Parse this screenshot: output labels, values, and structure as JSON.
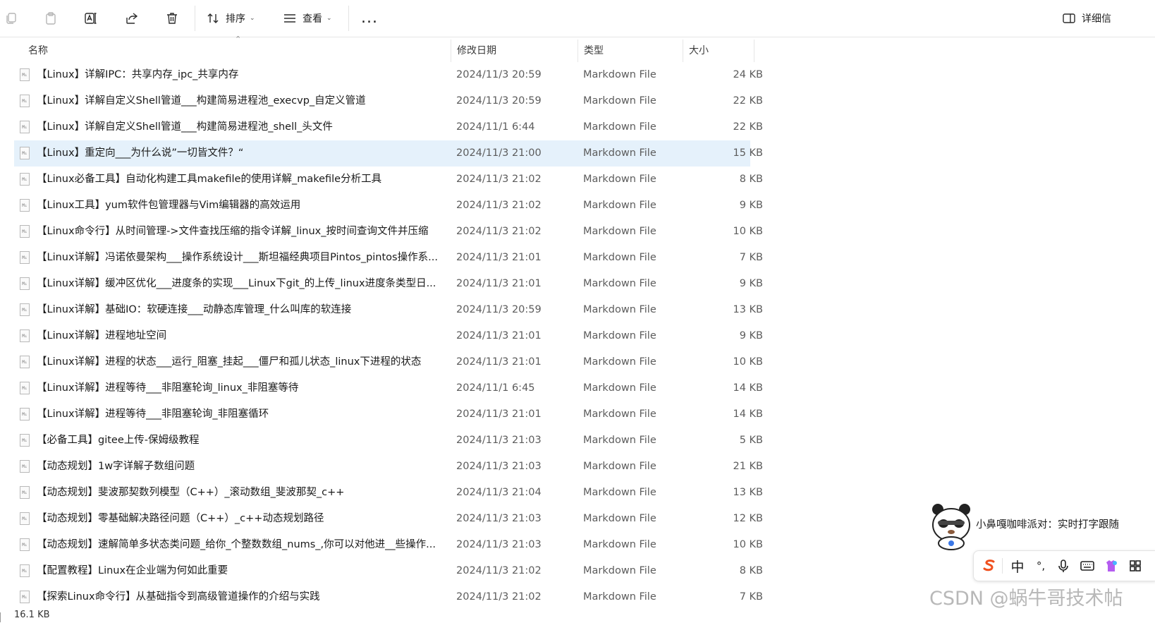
{
  "toolbar": {
    "sort_label": "排序",
    "view_label": "查看",
    "more_label": "...",
    "details_label": "详细信"
  },
  "columns": {
    "name": "名称",
    "date": "修改日期",
    "type": "类型",
    "size": "大小"
  },
  "files": [
    {
      "name": "【Linux】详解IPC：共享内存_ipc_共享内存",
      "date": "2024/11/3 20:59",
      "type": "Markdown File",
      "size": "24 KB"
    },
    {
      "name": "【Linux】详解自定义Shell管道___构建简易进程池_execvp_自定义管道",
      "date": "2024/11/3 20:59",
      "type": "Markdown File",
      "size": "22 KB"
    },
    {
      "name": "【Linux】详解自定义Shell管道___构建简易进程池_shell_头文件",
      "date": "2024/11/1 6:44",
      "type": "Markdown File",
      "size": "22 KB"
    },
    {
      "name": "【Linux】重定向___为什么说”一切皆文件？“",
      "date": "2024/11/3 21:00",
      "type": "Markdown File",
      "size": "15 KB",
      "selected": true
    },
    {
      "name": "【Linux必备工具】自动化构建工具makefile的使用详解_makefile分析工具",
      "date": "2024/11/3 21:02",
      "type": "Markdown File",
      "size": "8 KB"
    },
    {
      "name": "【Linux工具】yum软件包管理器与Vim编辑器的高效运用",
      "date": "2024/11/3 21:02",
      "type": "Markdown File",
      "size": "9 KB"
    },
    {
      "name": "【Linux命令行】从时间管理->文件查找压缩的指令详解_linux_按时间查询文件并压缩",
      "date": "2024/11/3 21:02",
      "type": "Markdown File",
      "size": "10 KB"
    },
    {
      "name": "【Linux详解】冯诺依曼架构___操作系统设计___斯坦福经典项目Pintos_pintos操作系...",
      "date": "2024/11/3 21:01",
      "type": "Markdown File",
      "size": "7 KB"
    },
    {
      "name": "【Linux详解】缓冲区优化___进度条的实现___Linux下git_的上传_linux进度条类型日...",
      "date": "2024/11/3 21:01",
      "type": "Markdown File",
      "size": "9 KB"
    },
    {
      "name": "【Linux详解】基础IO：软硬连接___动静态库管理_什么叫库的软连接",
      "date": "2024/11/3 20:59",
      "type": "Markdown File",
      "size": "13 KB"
    },
    {
      "name": "【Linux详解】进程地址空间",
      "date": "2024/11/3 21:01",
      "type": "Markdown File",
      "size": "9 KB"
    },
    {
      "name": "【Linux详解】进程的状态___运行_阻塞_挂起___僵尸和孤儿状态_linux下进程的状态",
      "date": "2024/11/3 21:01",
      "type": "Markdown File",
      "size": "10 KB"
    },
    {
      "name": "【Linux详解】进程等待___非阻塞轮询_linux_非阻塞等待",
      "date": "2024/11/1 6:45",
      "type": "Markdown File",
      "size": "14 KB"
    },
    {
      "name": "【Linux详解】进程等待___非阻塞轮询_非阻塞循环",
      "date": "2024/11/3 21:01",
      "type": "Markdown File",
      "size": "14 KB"
    },
    {
      "name": "【必备工具】gitee上传-保姆级教程",
      "date": "2024/11/3 21:03",
      "type": "Markdown File",
      "size": "5 KB"
    },
    {
      "name": "【动态规划】1w字详解子数组问题",
      "date": "2024/11/3 21:03",
      "type": "Markdown File",
      "size": "21 KB"
    },
    {
      "name": "【动态规划】斐波那契数列模型（C++）_滚动数组_斐波那契_c++",
      "date": "2024/11/3 21:04",
      "type": "Markdown File",
      "size": "13 KB"
    },
    {
      "name": "【动态规划】零基础解决路径问题（C++）_c++动态规划路径",
      "date": "2024/11/3 21:03",
      "type": "Markdown File",
      "size": "12 KB"
    },
    {
      "name": "【动态规划】速解简单多状态类问题_给你_个整数数组_nums_,你可以对他进__些操作...",
      "date": "2024/11/3 21:03",
      "type": "Markdown File",
      "size": "10 KB"
    },
    {
      "name": "【配置教程】Linux在企业端为何如此重要",
      "date": "2024/11/3 21:02",
      "type": "Markdown File",
      "size": "8 KB"
    },
    {
      "name": "【探索Linux命令行】从基础指令到高级管道操作的介绍与实践",
      "date": "2024/11/3 21:02",
      "type": "Markdown File",
      "size": "7 KB"
    }
  ],
  "status": {
    "text": "16.1 KB"
  },
  "ime": {
    "notice": "小鼻嘎咖啡派对：实时打字跟随",
    "lang": "中",
    "punct": "°,"
  },
  "watermark": "CSDN @蜗牛哥技术帖"
}
